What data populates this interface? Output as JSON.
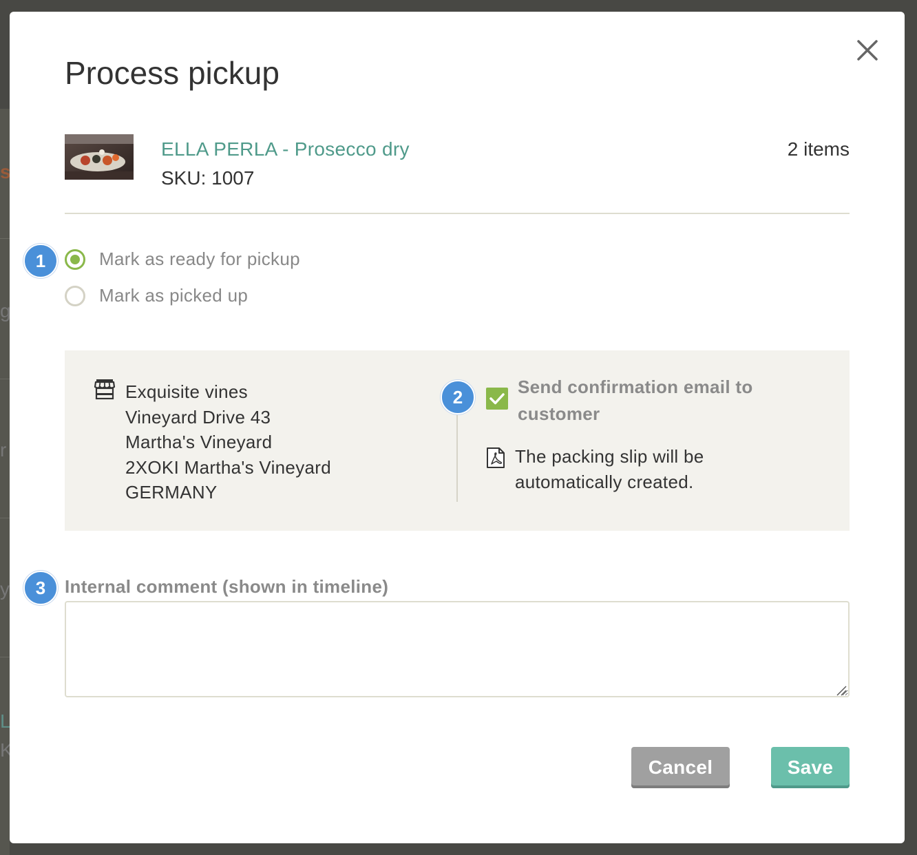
{
  "background": {
    "fragments": [
      "s",
      "g",
      "r",
      "y",
      "L",
      "K"
    ]
  },
  "modal": {
    "title": "Process pickup",
    "close_icon": "close-icon"
  },
  "product": {
    "name": "ELLA PERLA - Prosecco dry",
    "sku_label": "SKU: 1007",
    "item_count": "2 items",
    "thumbnail_icon": "product-photo"
  },
  "steps": {
    "step1": "1",
    "step2": "2",
    "step3": "3"
  },
  "pickup_options": [
    {
      "label": "Mark as ready for pickup",
      "selected": true
    },
    {
      "label": "Mark as picked up",
      "selected": false
    }
  ],
  "store": {
    "icon": "store-icon",
    "address_lines": [
      "Exquisite vines",
      "Vineyard Drive 43",
      "Martha's Vineyard",
      "2XOKI Martha's Vineyard",
      "GERMANY"
    ]
  },
  "notification": {
    "checkbox_checked": true,
    "email_label": "Send confirmation email to customer",
    "slip_icon": "pdf-icon",
    "slip_text": "The packing slip will be automatically created."
  },
  "comment": {
    "label": "Internal comment (shown in timeline)",
    "value": ""
  },
  "buttons": {
    "cancel": "Cancel",
    "save": "Save"
  },
  "colors": {
    "accent_green": "#8ab84a",
    "link_teal": "#4f9a8a",
    "save_button": "#6bbfab",
    "cancel_button": "#a0a0a0",
    "step_badge": "#4a90d9",
    "panel_bg": "#f3f2ed"
  }
}
